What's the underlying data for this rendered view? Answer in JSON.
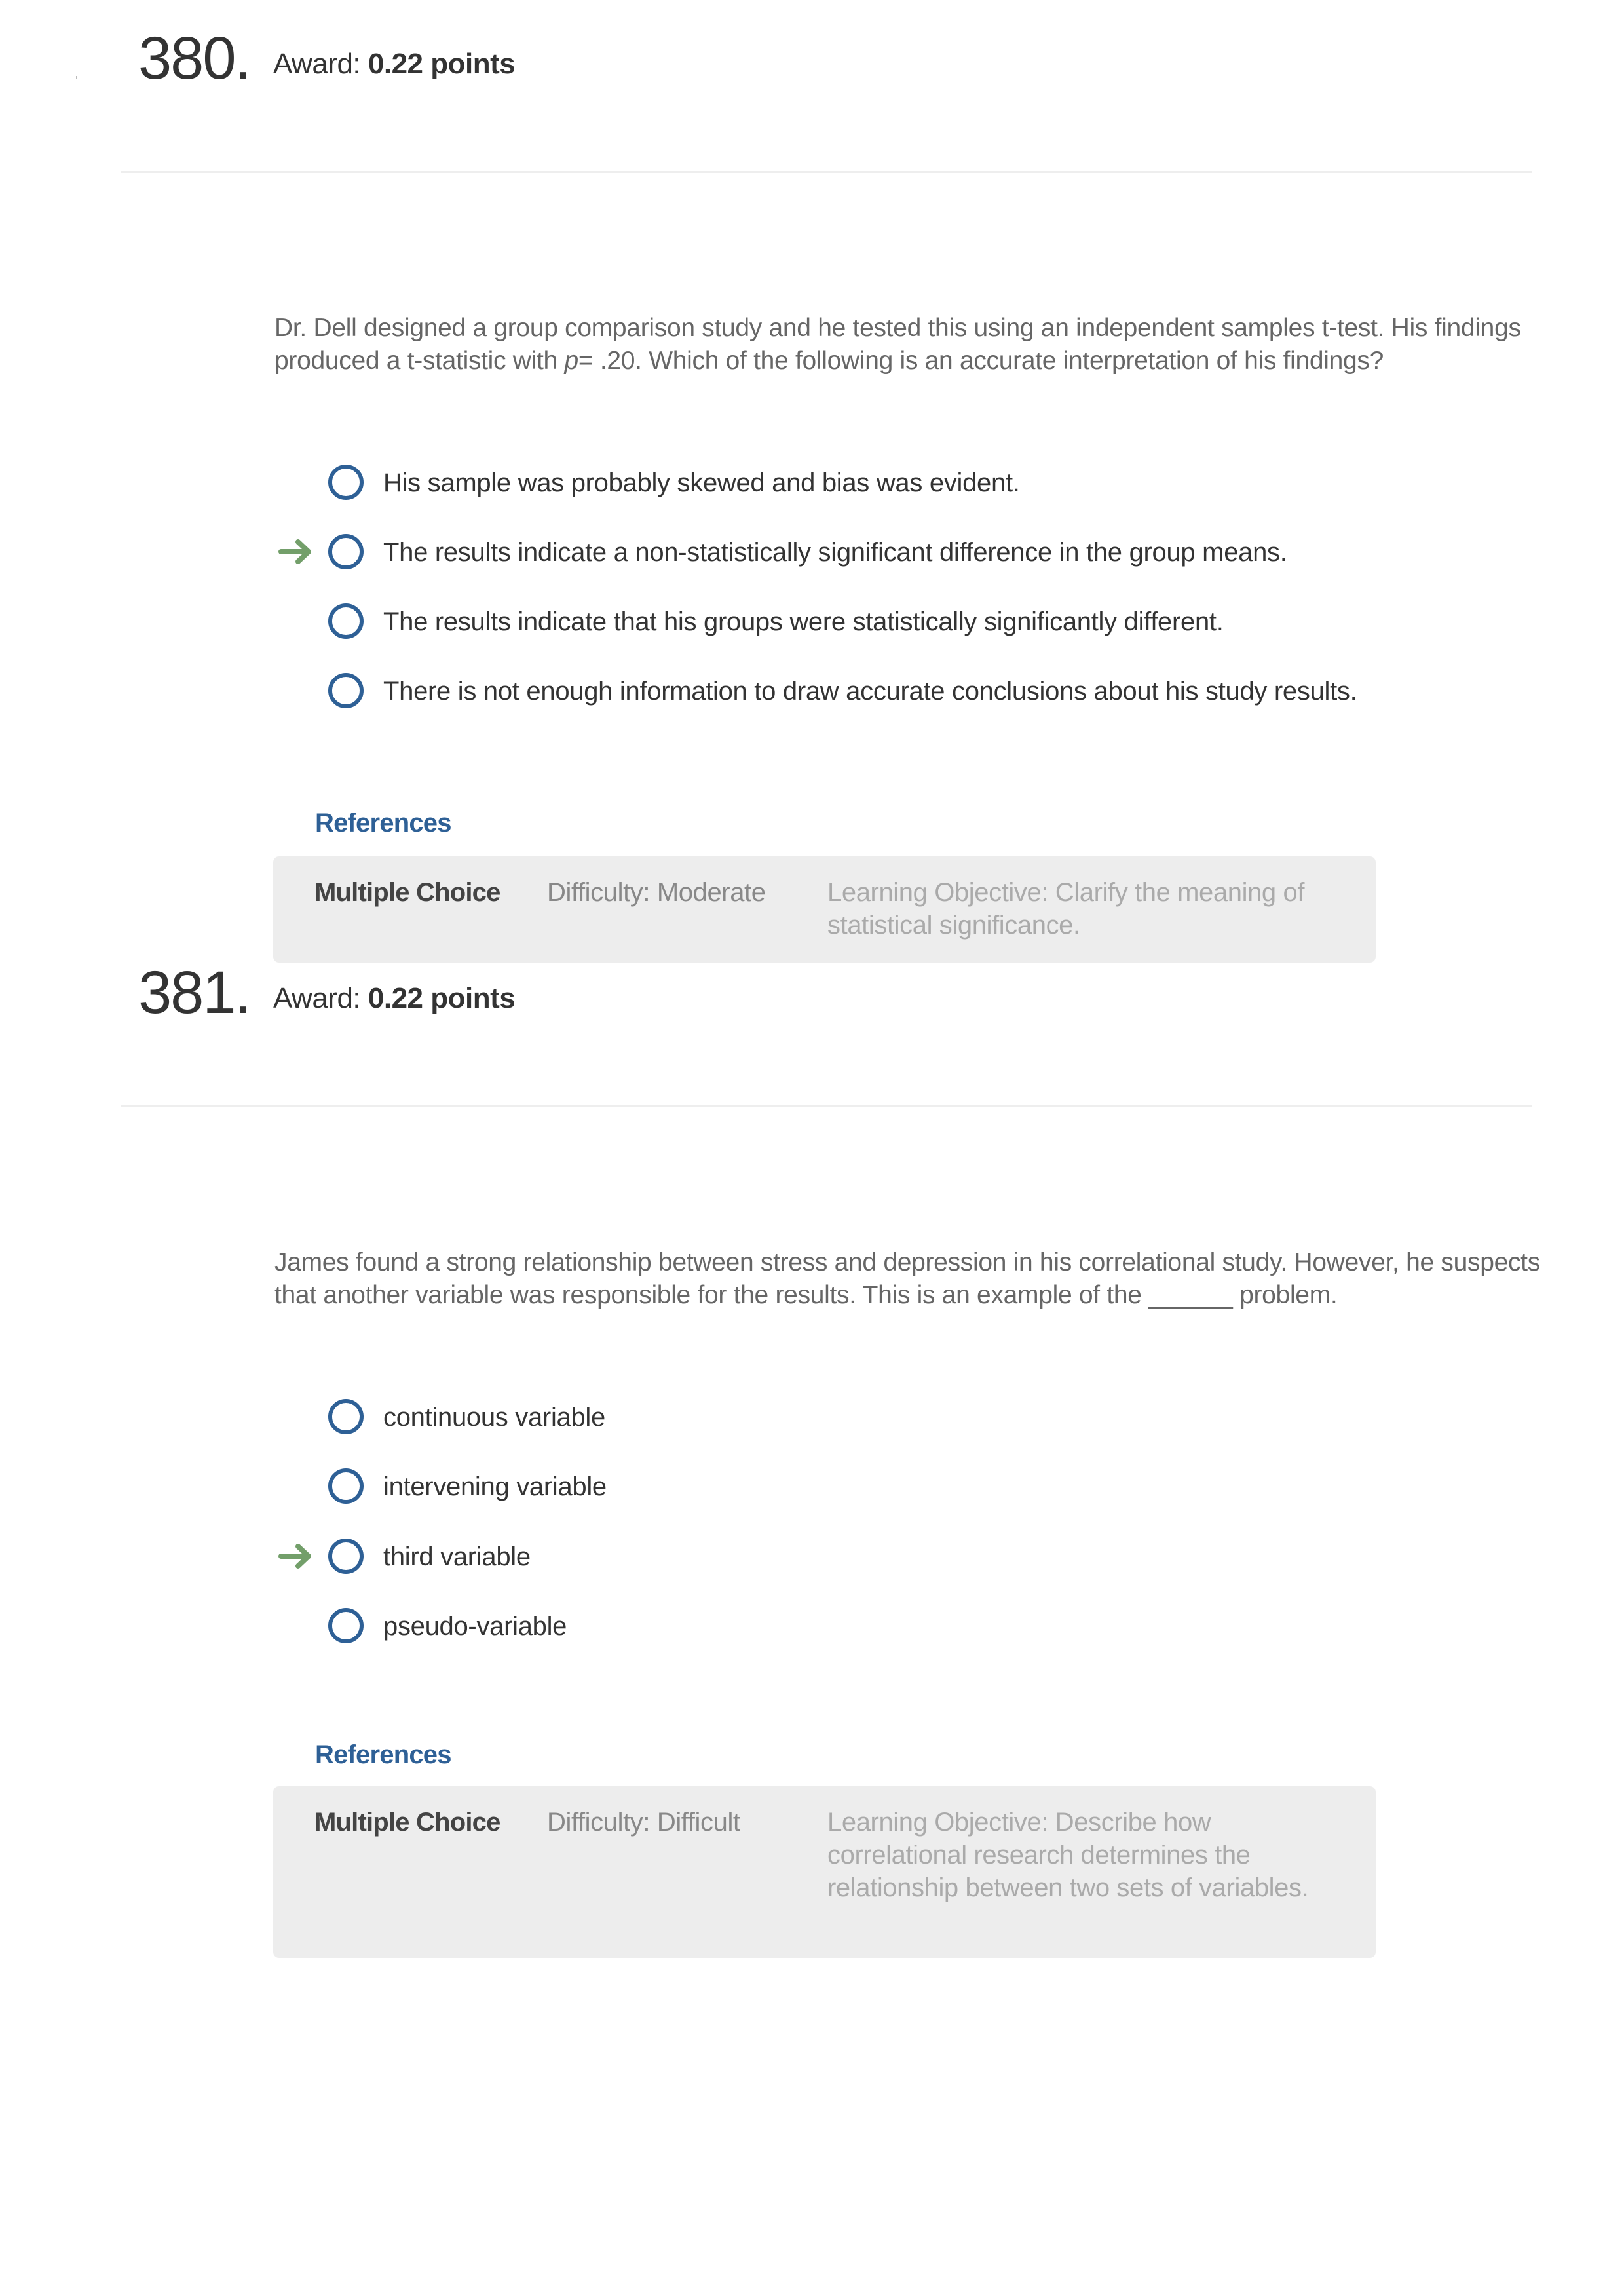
{
  "questions": [
    {
      "number": "380.",
      "award_label": "Award:",
      "award_points": "0.22 points",
      "stem": {
        "before_italic": "Dr. Dell designed a group comparison study and he tested this using an independent samples t-test. His findings produced a t-statistic with ",
        "italic": "p",
        "after_italic": "= .20. Which of the following is an accurate interpretation of his findings?"
      },
      "options": [
        {
          "text": "His sample was probably skewed and bias was evident.",
          "correct": false
        },
        {
          "text": "The results indicate a non-statistically significant difference in the group means.",
          "correct": true
        },
        {
          "text": "The results indicate that his groups were statistically significantly different.",
          "correct": false
        },
        {
          "text": "There is not enough information to draw accurate conclusions about his study results.",
          "correct": false
        }
      ],
      "references_title": "References",
      "reference": {
        "type": "Multiple Choice",
        "difficulty": "Difficulty: Moderate",
        "learning_objective": "Learning Objective: Clarify the meaning of statistical significance."
      }
    },
    {
      "number": "381.",
      "award_label": "Award:",
      "award_points": "0.22 points",
      "stem": {
        "before_italic": "James found a strong relationship between stress and depression in his correlational study. However, he suspects that another variable was responsible for the results. This is an example of the ______ problem.",
        "italic": "",
        "after_italic": ""
      },
      "options": [
        {
          "text": "continuous variable",
          "correct": false
        },
        {
          "text": "intervening variable",
          "correct": false
        },
        {
          "text": "third variable",
          "correct": true
        },
        {
          "text": "pseudo-variable",
          "correct": false
        }
      ],
      "references_title": "References",
      "reference": {
        "type": "Multiple Choice",
        "difficulty": "Difficulty: Difficult",
        "learning_objective": "Learning Objective: Describe how correlational research determines the relationship between two sets of variables."
      }
    }
  ],
  "icons": {
    "correct_answer_marker": "arrow-right-icon",
    "option_control": "radio-button-icon"
  },
  "colors": {
    "accent_blue": "#2e6096",
    "correct_arrow_green": "#739f6a",
    "reference_box_bg": "#ededed",
    "divider": "#eeeeee"
  }
}
